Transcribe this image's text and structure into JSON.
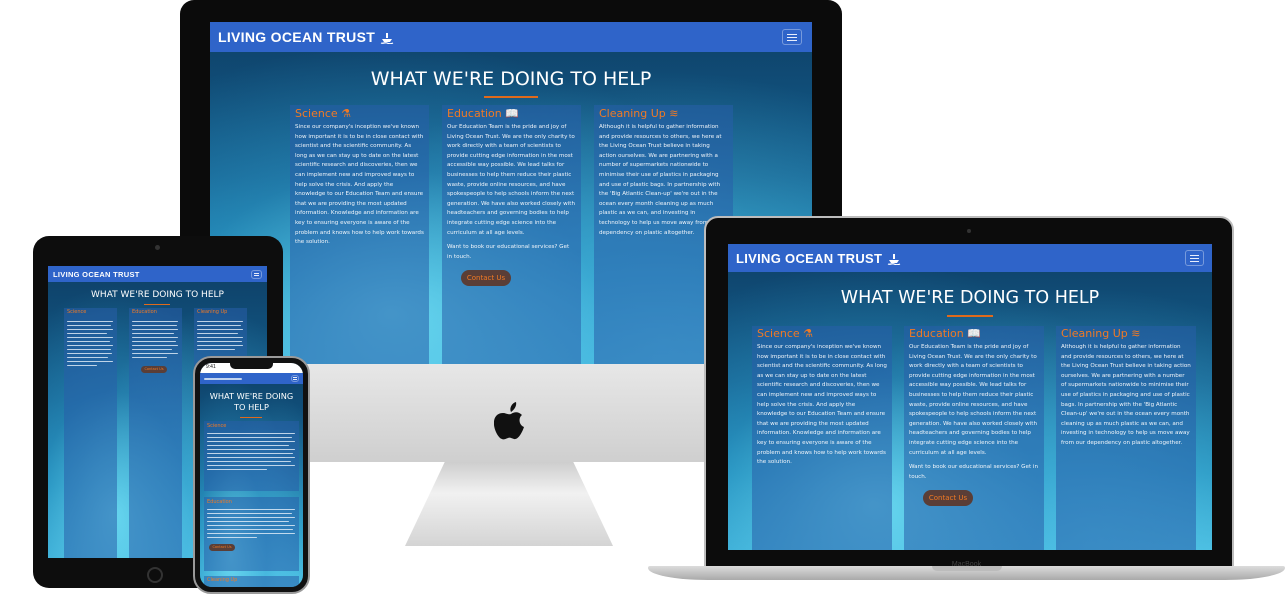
{
  "site": {
    "brand": "LIVING OCEAN TRUST",
    "heading": "WHAT WE'RE DOING TO HELP",
    "columns": [
      {
        "title": "Science",
        "icon": "flask-icon",
        "text": "Since our company's inception we've known how important it is to be in close contact with scientist and the scientific community. As long as we can stay up to date on the latest scientific research and discoveries, then we can implement new and improved ways to help solve the crisis. And apply the knowledge to our Education Team and ensure that we are providing the most updated information. Knowledge and information are key to ensuring everyone is aware of the problem and knows how to help work towards the solution."
      },
      {
        "title": "Education",
        "icon": "book-icon",
        "text": "Our Education Team is the pride and joy of Living Ocean Trust. We are the only charity to work directly with a team of scientists to provide cutting edge information in the most accessible way possible. We lead talks for businesses to help them reduce their plastic waste, provide online resources, and have spokespeople to help schools inform the next generation. We have also worked closely with headteachers and governing bodies to help integrate cutting edge science into the curriculum at all age levels.",
        "extra": "Want to book our educational services? Get in touch.",
        "button": "Contact Us"
      },
      {
        "title": "Cleaning Up",
        "icon": "waves-icon",
        "text": "Although it is helpful to gather information and provide resources to others, we here at the Living Ocean Trust believe in taking action ourselves. We are partnering with a number of supermarkets nationwide to minimise their use of plastics in packaging and use of plastic bags. In partnership with the 'Big Atlantic Clean-up' we're out in the ocean every month cleaning up as much plastic as we can, and investing in technology to help us move away from our dependency on plastic altogether."
      }
    ]
  },
  "phone": {
    "time": "9:41"
  },
  "devices": {
    "laptop_label": "MacBook"
  },
  "colors": {
    "navbar": "#2f64c9",
    "accent": "#f07a25",
    "button_bg": "#5a3e37"
  }
}
